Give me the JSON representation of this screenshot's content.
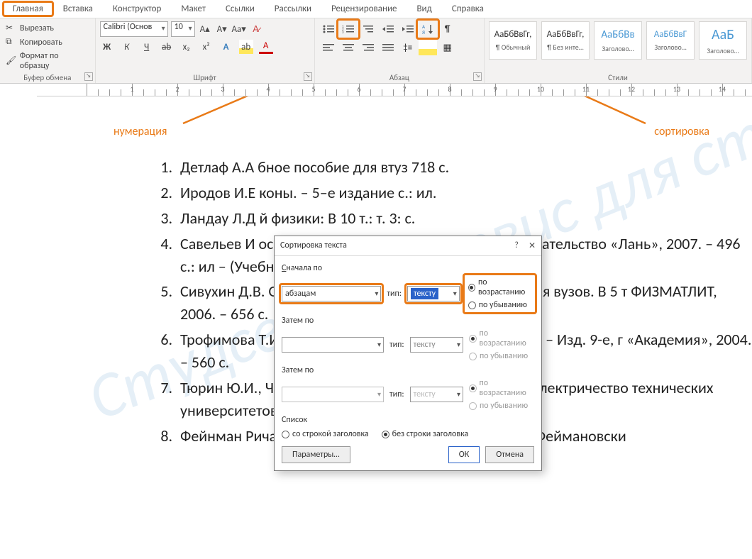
{
  "menu": {
    "items": [
      "Главная",
      "Вставка",
      "Конструктор",
      "Макет",
      "Ссылки",
      "Рассылки",
      "Рецензирование",
      "Вид",
      "Справка"
    ],
    "active": 0
  },
  "ribbon": {
    "clipboard": {
      "cut": "Вырезать",
      "copy": "Копировать",
      "format_painter": "Формат по образцу",
      "label": "Буфер обмена"
    },
    "font": {
      "name": "Calibri (Основ",
      "size": "10",
      "label": "Шрифт"
    },
    "paragraph": {
      "label": "Абзац"
    },
    "styles": {
      "label": "Стили",
      "items": [
        {
          "sample": "АаБбВвГг,",
          "name": "¶ Обычный"
        },
        {
          "sample": "АаБбВвГг,",
          "name": "¶ Без инте…"
        },
        {
          "sample": "АаБбВв",
          "name": "Заголово…",
          "blue": true,
          "size": "16px"
        },
        {
          "sample": "АаБбВвГ",
          "name": "Заголово…",
          "blue": true
        },
        {
          "sample": "АаБ",
          "name": "Заголово…",
          "blue": true,
          "big": true
        }
      ]
    }
  },
  "annotation": {
    "numbering": "нумерация",
    "sort": "сортировка"
  },
  "biblio": [
    "Детлаф А.А                                                   бное пособие для втуз  718 с.",
    "Иродов И.Е                                                   коны. – 5–е издание  с.: ил.",
    "Ландау Л.Д                                                   й физики: В 10 т.: т. 3:  с.",
    "Савельев И                                                    особие. В 3–х тт. Т.2:  изд., стер. – СПб.: Издательство «Лань», 2007. – 496 с.: ил – (Учебни",
    "Сивухин Д.В. Общий курс физики: учебное пособие для вузов. В 5 т  ФИЗМАТЛИТ, 2006. – 656 с.",
    "Трофимова Т.И. Курс физики: учеб. пособие для вузов. – Изд. 9-е, г  «Академия», 2004. – 560 с.",
    "Тюрин Ю.И., Чернов И.П., Крючков Ю.Ю. Физика ч.2. Электричество  технических университетов. – Томск: Изд-во Томского ун-та, 2003.",
    "Фейнман Ричард Ф., Лейтон Роберт Б., Сэндс Метью. Феймановски"
  ],
  "dialog": {
    "title": "Сортировка текста",
    "section_first": "Сначала по",
    "section_then1": "Затем по",
    "section_then2": "Затем по",
    "section_list": "Список",
    "select_by": "абзацам",
    "type_label": "тип:",
    "select_type": "тексту",
    "asc": "по возрастанию",
    "desc": "по убыванию",
    "list_with_header": "со строкой заголовка",
    "list_without_header": "без строки заголовка",
    "params": "Параметры…",
    "ok": "ОК",
    "cancel": "Отмена"
  },
  "watermark": "Студсервис  сервис для студентов"
}
